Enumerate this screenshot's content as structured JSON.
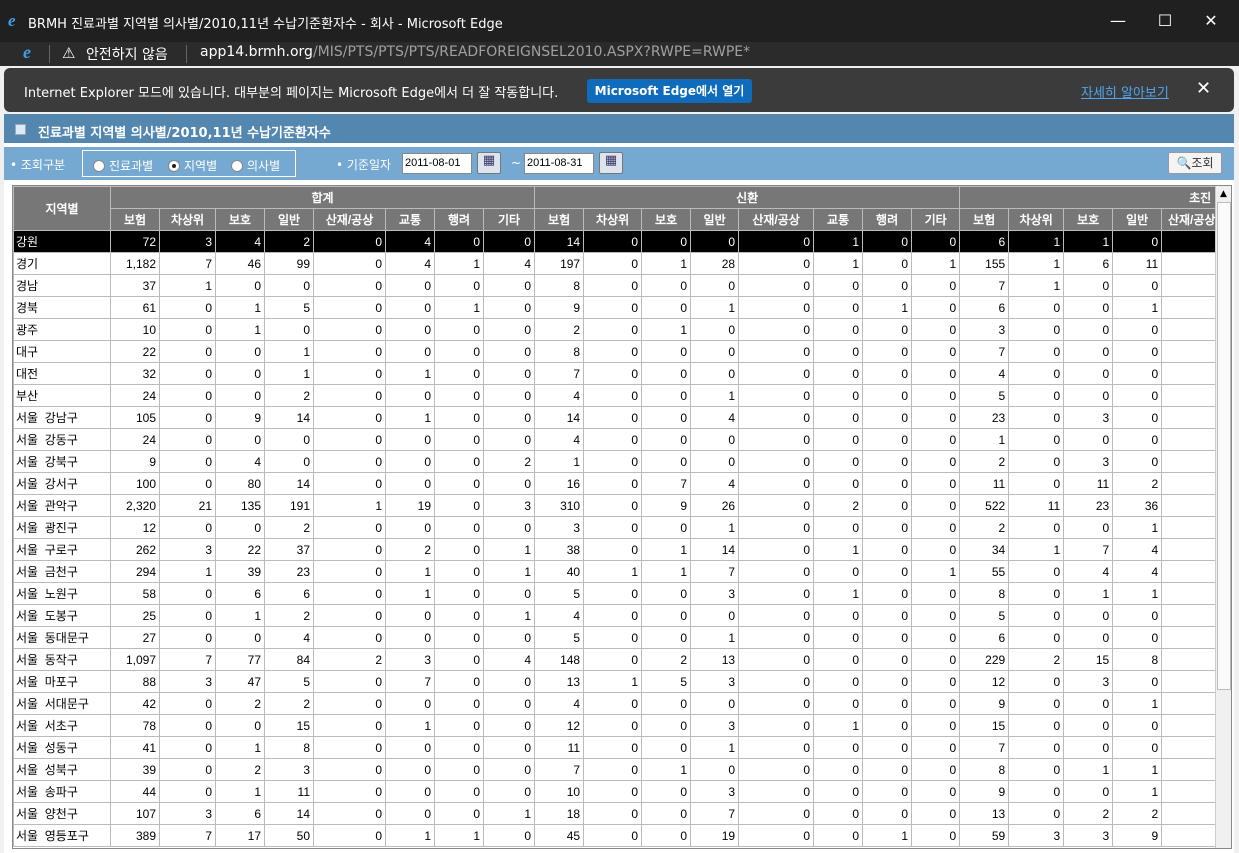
{
  "window": {
    "title": "BRMH 진료과별 지역별 의사별/2010,11년 수납기준환자수 - 회사 - Microsoft Edge",
    "minimize": "—",
    "maximize": "☐",
    "close": "✕"
  },
  "address": {
    "security": "안전하지 않음",
    "url_host": "app14.brmh.org",
    "url_path": "/MIS/PTS/PTS/PTS/READFOREIGNSEL2010.ASPX?RWPE=RWPE*"
  },
  "banner": {
    "message": "Internet Explorer 모드에 있습니다. 대부분의 페이지는 Microsoft Edge에서 더 잘 작동합니다.",
    "open_button": "Microsoft Edge에서 열기",
    "learn_more": "자세히 알아보기",
    "close": "✕"
  },
  "page": {
    "title": "진료과별 지역별 의사별/2010,11년 수납기준환자수"
  },
  "filter": {
    "type_label": "• 조회구분",
    "options": [
      "진료과별",
      "지역별",
      "의사별"
    ],
    "selected": "지역별",
    "date_label": "• 기준일자",
    "date_from": "2011-08-01",
    "tilde": "~",
    "date_to": "2011-08-31",
    "search_button": "조회"
  },
  "table": {
    "region_header": "지역별",
    "groups": [
      "합계",
      "신환",
      "초진"
    ],
    "subcolumns": [
      "보험",
      "차상위",
      "보호",
      "일반",
      "산재/공상",
      "교통",
      "행려",
      "기타"
    ],
    "rows": [
      [
        "강원",
        "72",
        "3",
        "4",
        "2",
        "0",
        "4",
        "0",
        "0",
        "14",
        "0",
        "0",
        "0",
        "0",
        "1",
        "0",
        "0",
        "6",
        "1",
        "1",
        "0"
      ],
      [
        "경기",
        "1,182",
        "7",
        "46",
        "99",
        "0",
        "4",
        "1",
        "4",
        "197",
        "0",
        "1",
        "28",
        "0",
        "1",
        "0",
        "1",
        "155",
        "1",
        "6",
        "11"
      ],
      [
        "경남",
        "37",
        "1",
        "0",
        "0",
        "0",
        "0",
        "0",
        "0",
        "8",
        "0",
        "0",
        "0",
        "0",
        "0",
        "0",
        "0",
        "7",
        "1",
        "0",
        "0"
      ],
      [
        "경북",
        "61",
        "0",
        "1",
        "5",
        "0",
        "0",
        "1",
        "0",
        "9",
        "0",
        "0",
        "1",
        "0",
        "0",
        "1",
        "0",
        "6",
        "0",
        "0",
        "1"
      ],
      [
        "광주",
        "10",
        "0",
        "1",
        "0",
        "0",
        "0",
        "0",
        "0",
        "2",
        "0",
        "1",
        "0",
        "0",
        "0",
        "0",
        "0",
        "3",
        "0",
        "0",
        "0"
      ],
      [
        "대구",
        "22",
        "0",
        "0",
        "1",
        "0",
        "0",
        "0",
        "0",
        "8",
        "0",
        "0",
        "0",
        "0",
        "0",
        "0",
        "0",
        "7",
        "0",
        "0",
        "0"
      ],
      [
        "대전",
        "32",
        "0",
        "0",
        "1",
        "0",
        "1",
        "0",
        "0",
        "7",
        "0",
        "0",
        "0",
        "0",
        "0",
        "0",
        "0",
        "4",
        "0",
        "0",
        "0"
      ],
      [
        "부산",
        "24",
        "0",
        "0",
        "2",
        "0",
        "0",
        "0",
        "0",
        "4",
        "0",
        "0",
        "1",
        "0",
        "0",
        "0",
        "0",
        "5",
        "0",
        "0",
        "0"
      ],
      [
        "서울  강남구",
        "105",
        "0",
        "9",
        "14",
        "0",
        "1",
        "0",
        "0",
        "14",
        "0",
        "0",
        "4",
        "0",
        "0",
        "0",
        "0",
        "23",
        "0",
        "3",
        "0"
      ],
      [
        "서울  강동구",
        "24",
        "0",
        "0",
        "0",
        "0",
        "0",
        "0",
        "0",
        "4",
        "0",
        "0",
        "0",
        "0",
        "0",
        "0",
        "0",
        "1",
        "0",
        "0",
        "0"
      ],
      [
        "서울  강북구",
        "9",
        "0",
        "4",
        "0",
        "0",
        "0",
        "0",
        "2",
        "1",
        "0",
        "0",
        "0",
        "0",
        "0",
        "0",
        "0",
        "2",
        "0",
        "3",
        "0"
      ],
      [
        "서울  강서구",
        "100",
        "0",
        "80",
        "14",
        "0",
        "0",
        "0",
        "0",
        "16",
        "0",
        "7",
        "4",
        "0",
        "0",
        "0",
        "0",
        "11",
        "0",
        "11",
        "2"
      ],
      [
        "서울  관악구",
        "2,320",
        "21",
        "135",
        "191",
        "1",
        "19",
        "0",
        "3",
        "310",
        "0",
        "9",
        "26",
        "0",
        "2",
        "0",
        "0",
        "522",
        "11",
        "23",
        "36"
      ],
      [
        "서울  광진구",
        "12",
        "0",
        "0",
        "2",
        "0",
        "0",
        "0",
        "0",
        "3",
        "0",
        "0",
        "1",
        "0",
        "0",
        "0",
        "0",
        "2",
        "0",
        "0",
        "1"
      ],
      [
        "서울  구로구",
        "262",
        "3",
        "22",
        "37",
        "0",
        "2",
        "0",
        "1",
        "38",
        "0",
        "1",
        "14",
        "0",
        "1",
        "0",
        "0",
        "34",
        "1",
        "7",
        "4"
      ],
      [
        "서울  금천구",
        "294",
        "1",
        "39",
        "23",
        "0",
        "1",
        "0",
        "1",
        "40",
        "1",
        "1",
        "7",
        "0",
        "0",
        "0",
        "1",
        "55",
        "0",
        "4",
        "4"
      ],
      [
        "서울  노원구",
        "58",
        "0",
        "6",
        "6",
        "0",
        "1",
        "0",
        "0",
        "5",
        "0",
        "0",
        "3",
        "0",
        "1",
        "0",
        "0",
        "8",
        "0",
        "1",
        "1"
      ],
      [
        "서울  도봉구",
        "25",
        "0",
        "1",
        "2",
        "0",
        "0",
        "0",
        "1",
        "4",
        "0",
        "0",
        "0",
        "0",
        "0",
        "0",
        "0",
        "5",
        "0",
        "0",
        "0"
      ],
      [
        "서울  동대문구",
        "27",
        "0",
        "0",
        "4",
        "0",
        "0",
        "0",
        "0",
        "5",
        "0",
        "0",
        "1",
        "0",
        "0",
        "0",
        "0",
        "6",
        "0",
        "0",
        "0"
      ],
      [
        "서울  동작구",
        "1,097",
        "7",
        "77",
        "84",
        "2",
        "3",
        "0",
        "4",
        "148",
        "0",
        "2",
        "13",
        "0",
        "0",
        "0",
        "0",
        "229",
        "2",
        "15",
        "8"
      ],
      [
        "서울  마포구",
        "88",
        "3",
        "47",
        "5",
        "0",
        "7",
        "0",
        "0",
        "13",
        "1",
        "5",
        "3",
        "0",
        "0",
        "0",
        "0",
        "12",
        "0",
        "3",
        "0"
      ],
      [
        "서울  서대문구",
        "42",
        "0",
        "2",
        "2",
        "0",
        "0",
        "0",
        "0",
        "4",
        "0",
        "0",
        "0",
        "0",
        "0",
        "0",
        "0",
        "9",
        "0",
        "0",
        "1"
      ],
      [
        "서울  서초구",
        "78",
        "0",
        "0",
        "15",
        "0",
        "1",
        "0",
        "0",
        "12",
        "0",
        "0",
        "3",
        "0",
        "1",
        "0",
        "0",
        "15",
        "0",
        "0",
        "0"
      ],
      [
        "서울  성동구",
        "41",
        "0",
        "1",
        "8",
        "0",
        "0",
        "0",
        "0",
        "11",
        "0",
        "0",
        "1",
        "0",
        "0",
        "0",
        "0",
        "7",
        "0",
        "0",
        "0"
      ],
      [
        "서울  성북구",
        "39",
        "0",
        "2",
        "3",
        "0",
        "0",
        "0",
        "0",
        "7",
        "0",
        "1",
        "0",
        "0",
        "0",
        "0",
        "0",
        "8",
        "0",
        "1",
        "1"
      ],
      [
        "서울  송파구",
        "44",
        "0",
        "1",
        "11",
        "0",
        "0",
        "0",
        "0",
        "10",
        "0",
        "0",
        "3",
        "0",
        "0",
        "0",
        "0",
        "9",
        "0",
        "0",
        "1"
      ],
      [
        "서울  양천구",
        "107",
        "3",
        "6",
        "14",
        "0",
        "0",
        "0",
        "1",
        "18",
        "0",
        "0",
        "7",
        "0",
        "0",
        "0",
        "0",
        "13",
        "0",
        "2",
        "2"
      ],
      [
        "서울  영등포구",
        "389",
        "7",
        "17",
        "50",
        "0",
        "1",
        "1",
        "0",
        "45",
        "0",
        "0",
        "19",
        "0",
        "0",
        "1",
        "0",
        "59",
        "3",
        "3",
        "9"
      ]
    ],
    "selected_row": 0
  }
}
